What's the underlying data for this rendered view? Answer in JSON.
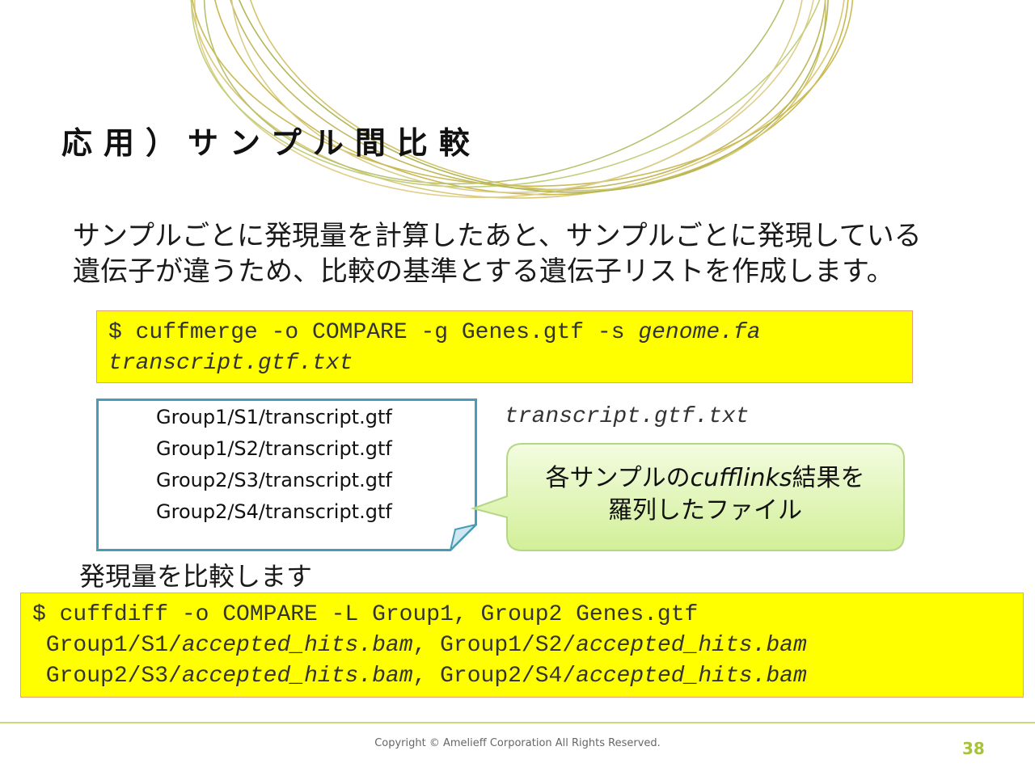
{
  "slide": {
    "title": "応用）サンプル間比較",
    "intro_line1": "サンプルごとに発現量を計算したあと、サンプルごとに発現している",
    "intro_line2": "遺伝子が違うため、比較の基準とする遺伝子リストを作成します。",
    "cmd1": {
      "line1_plain": "$ cuffmerge -o COMPARE -g Genes.gtf -s ",
      "line1_italic": "genome.fa",
      "line2_italic": "transcript.gtf.txt"
    },
    "file_list": [
      "Group1/S1/transcript.gtf",
      "Group1/S2/transcript.gtf",
      "Group2/S3/transcript.gtf",
      "Group2/S4/transcript.gtf"
    ],
    "file_name": "transcript.gtf.txt",
    "callout": {
      "part1": "各サンプルの",
      "part2_italic": "cufflinks",
      "part3": "結果を",
      "line2": "羅列したファイル"
    },
    "compare_label": "発現量を比較します",
    "cmd2": {
      "line1": "$ cuffdiff -o COMPARE -L Group1, Group2 Genes.gtf",
      "l2_a": " Group1/S1/",
      "l2_b": "accepted_hits.bam",
      "l2_c": ", Group1/S2/",
      "l2_d": "accepted_hits.bam",
      "l3_a": " Group2/S3/",
      "l3_b": "accepted_hits.bam",
      "l3_c": ", Group2/S4/",
      "l3_d": "accepted_hits.bam"
    },
    "copyright": "Copyright © Amelieff Corporation All Rights Reserved.",
    "page_number": "38",
    "colors": {
      "code_bg": "#ffff00",
      "code_border": "#e8a07a",
      "file_box_border": "#4a9bb5",
      "callout_fill": "#e2f5b8",
      "accent": "#a8c23a"
    }
  }
}
